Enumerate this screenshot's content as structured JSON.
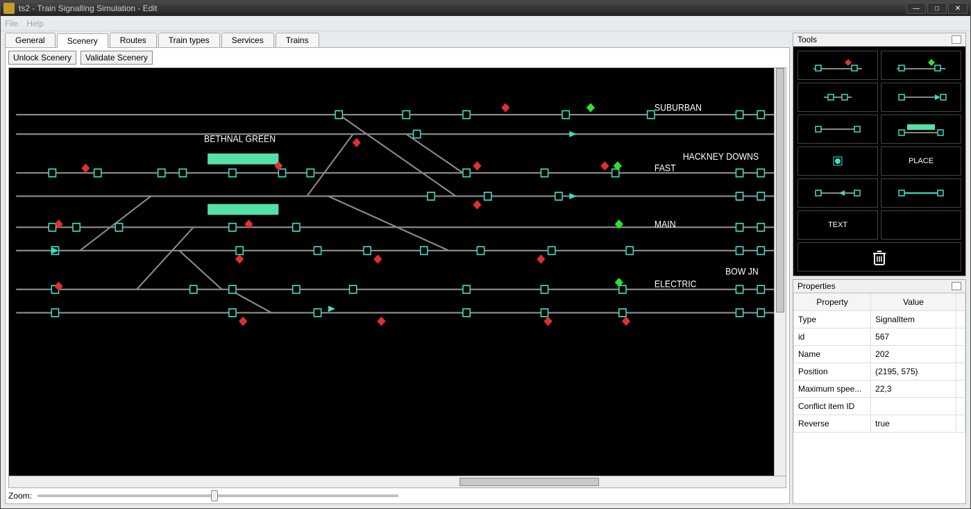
{
  "window": {
    "title": "ts2 - Train Signalling Simulation - Edit"
  },
  "menu": {
    "file": "File",
    "help": "Help"
  },
  "tabs": {
    "items": [
      "General",
      "Scenery",
      "Routes",
      "Train types",
      "Services",
      "Trains"
    ],
    "active": "Scenery"
  },
  "scenery": {
    "unlock_btn": "Unlock Scenery",
    "validate_btn": "Validate Scenery",
    "labels": {
      "bethnal": "BETHNAL GREEN",
      "suburban": "SUBURBAN",
      "hackney": "HACKNEY DOWNS",
      "fast": "FAST",
      "main": "MAIN",
      "bowjn": "BOW JN",
      "electric": "ELECTRIC"
    }
  },
  "zoom": {
    "label": "Zoom:"
  },
  "tools_panel": {
    "title": "Tools",
    "place": "PLACE",
    "text": "TEXT"
  },
  "properties_panel": {
    "title": "Properties",
    "col_property": "Property",
    "col_value": "Value",
    "rows": [
      {
        "p": "Type",
        "v": "SignalItem"
      },
      {
        "p": "id",
        "v": "567"
      },
      {
        "p": "Name",
        "v": "202"
      },
      {
        "p": "Position",
        "v": "(2195, 575)"
      },
      {
        "p": "Maximum spee...",
        "v": "22,3"
      },
      {
        "p": "Conflict item ID",
        "v": ""
      },
      {
        "p": "Reverse",
        "v": "true"
      }
    ]
  }
}
